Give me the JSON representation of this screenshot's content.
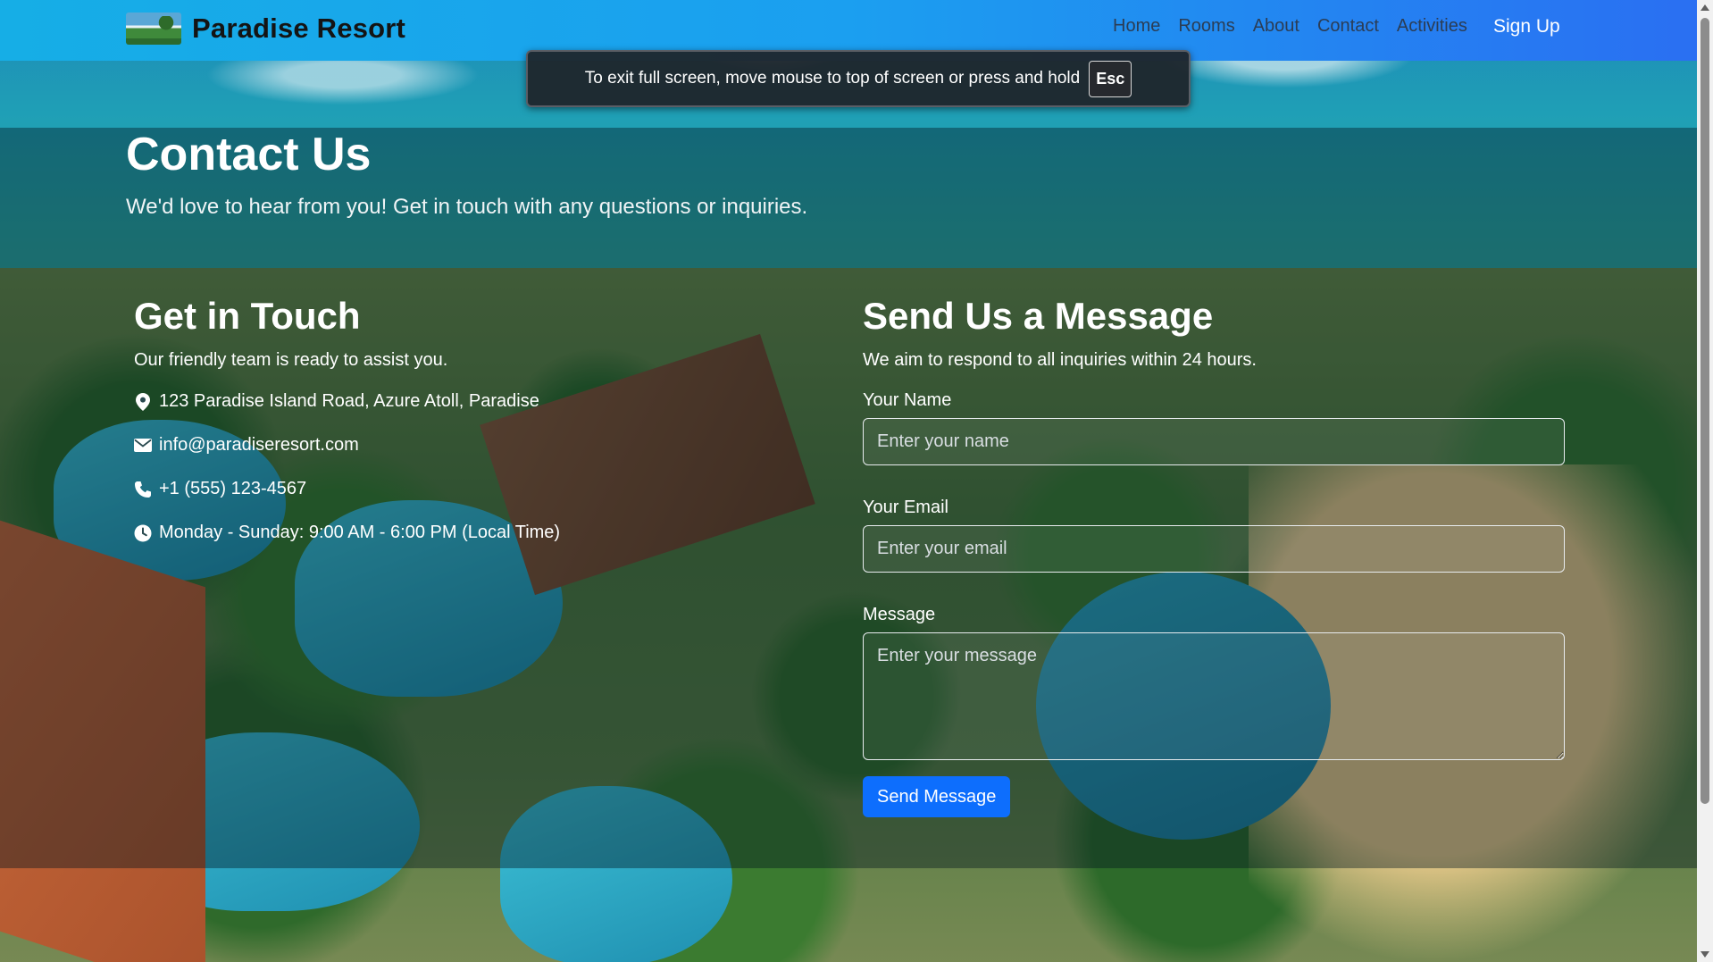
{
  "window": {
    "fullscreen_notice": "To exit full screen, move mouse to top of screen or press and hold",
    "fullscreen_key": "Esc"
  },
  "navbar": {
    "brand_name": "Paradise Resort",
    "links": [
      {
        "label": "Home"
      },
      {
        "label": "Rooms"
      },
      {
        "label": "About"
      },
      {
        "label": "Contact"
      },
      {
        "label": "Activities"
      }
    ],
    "signup_label": "Sign Up",
    "link_color": "#2b3d55",
    "gradient_start": "#16aee6",
    "gradient_end": "#2a6ff2"
  },
  "header": {
    "title": "Contact Us",
    "subtitle": "We'd love to hear from you! Get in touch with any questions or inquiries."
  },
  "contact_info": {
    "title": "Get in Touch",
    "subtitle": "Our friendly team is ready to assist you.",
    "items": [
      {
        "icon": "map-marker-icon",
        "text": "123 Paradise Island Road, Azure Atoll, Paradise"
      },
      {
        "icon": "envelope-icon",
        "text": "info@paradiseresort.com"
      },
      {
        "icon": "phone-icon",
        "text": "+1 (555) 123-4567"
      },
      {
        "icon": "clock-icon",
        "text": "Monday - Sunday: 9:00 AM - 6:00 PM (Local Time)"
      }
    ]
  },
  "message_form": {
    "title": "Send Us a Message",
    "subtitle": "We aim to respond to all inquiries within 24 hours.",
    "name_label": "Your Name",
    "name_placeholder": "Enter your name",
    "name_value": "",
    "email_label": "Your Email",
    "email_placeholder": "Enter your email",
    "email_value": "",
    "message_label": "Message",
    "message_placeholder": "Enter your message",
    "message_value": "",
    "submit_label": "Send Message",
    "submit_color": "#0d6efd"
  }
}
